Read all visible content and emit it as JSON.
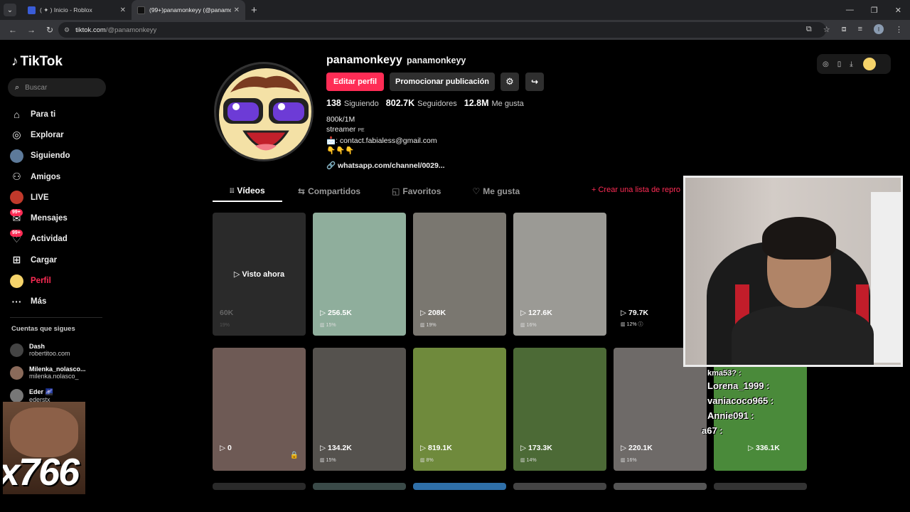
{
  "browser": {
    "tabs": [
      {
        "title": "( ✦ ) Inicio - Roblox",
        "close": "✕"
      },
      {
        "title": "(99+)panamonkeyy (@panamo...",
        "close": "✕"
      }
    ],
    "new_tab": "+",
    "url_host": "tiktok.com",
    "url_path": "/@panamonkeyy",
    "profile_initial": "I"
  },
  "sidebar": {
    "logo": "TikTok",
    "search_placeholder": "Buscar",
    "items": [
      {
        "label": "Para ti",
        "icon": "⌂"
      },
      {
        "label": "Explorar",
        "icon": "◎"
      },
      {
        "label": "Siguiendo",
        "icon": "●"
      },
      {
        "label": "Amigos",
        "icon": "⚇"
      },
      {
        "label": "LIVE",
        "icon": "●"
      },
      {
        "label": "Mensajes",
        "icon": "✉",
        "badge": "99+"
      },
      {
        "label": "Actividad",
        "icon": "♡",
        "badge": "99+"
      },
      {
        "label": "Cargar",
        "icon": "⊞"
      },
      {
        "label": "Perfil",
        "icon": "●"
      },
      {
        "label": "Más",
        "icon": "···"
      }
    ],
    "following_title": "Cuentas que sigues",
    "following": [
      {
        "name": "Dash",
        "handle": "robertitoo.com"
      },
      {
        "name": "Milenka_nolasco...",
        "handle": "milenka.nolasco_"
      },
      {
        "name": "Eder 🌌",
        "handle": "ederstx"
      }
    ]
  },
  "overlay_text": "x766",
  "profile": {
    "name": "panamonkeyy",
    "handle": "panamonkeyy",
    "edit_label": "Editar perfil",
    "promote_label": "Promocionar publicación",
    "stats": [
      {
        "value": "138",
        "label": "Siguiendo"
      },
      {
        "value": "802.7K",
        "label": "Seguidores"
      },
      {
        "value": "12.8M",
        "label": "Me gusta"
      }
    ],
    "bio_line1": "800k/1M",
    "bio_line2": "streamer",
    "bio_flag": "PE",
    "bio_line3": "📩: contact.fabialess@gmail.com",
    "bio_line4": "👇👇👇",
    "link": "whatsapp.com/channel/0029..."
  },
  "tabs": [
    {
      "label": "Vídeos",
      "icon": "⦙⦙⦙"
    },
    {
      "label": "Compartidos",
      "icon": "⇆"
    },
    {
      "label": "Favoritos",
      "icon": "◱"
    },
    {
      "label": "Me gusta",
      "icon": "♡"
    }
  ],
  "create_playlist": "+ Crear una lista de repro",
  "videos": [
    {
      "views": "60K",
      "pct": "19%",
      "watched": "▷ Visto ahora",
      "bg": "#2a2a2a"
    },
    {
      "views": "▷ 256.5K",
      "pct": "▥ 15%",
      "bg": "#8fae9c"
    },
    {
      "views": "▷ 208K",
      "pct": "▥ 19%",
      "bg": "#7a7770"
    },
    {
      "views": "▷ 127.6K",
      "pct": "▥ 16%",
      "bg": "#9b9a95"
    },
    {
      "views": "▷ 79.7K",
      "pct": "▥ 12% ⓘ",
      "bg": "#000000"
    },
    {
      "views": "▷ 0",
      "pct": "",
      "lock": "🔒",
      "bg": "#6e5a55"
    },
    {
      "views": "▷ 134.2K",
      "pct": "▥ 15%",
      "bg": "#55524e"
    },
    {
      "views": "▷ 819.1K",
      "pct": "▥ 8%",
      "bg": "#6f8a3c"
    },
    {
      "views": "▷ 173.3K",
      "pct": "▥ 14%",
      "bg": "#4c6a36"
    },
    {
      "views": "▷ 220.1K",
      "pct": "▥ 16%",
      "bg": "#6e6a68"
    },
    {
      "views": "▷ 336.1K",
      "pct": "",
      "bg": "#4a8a3a"
    }
  ],
  "chat": [
    "kma53? :",
    "Lorena_1999 :",
    "vaniacoco965 :",
    "Annie091 :",
    "a67 :"
  ]
}
